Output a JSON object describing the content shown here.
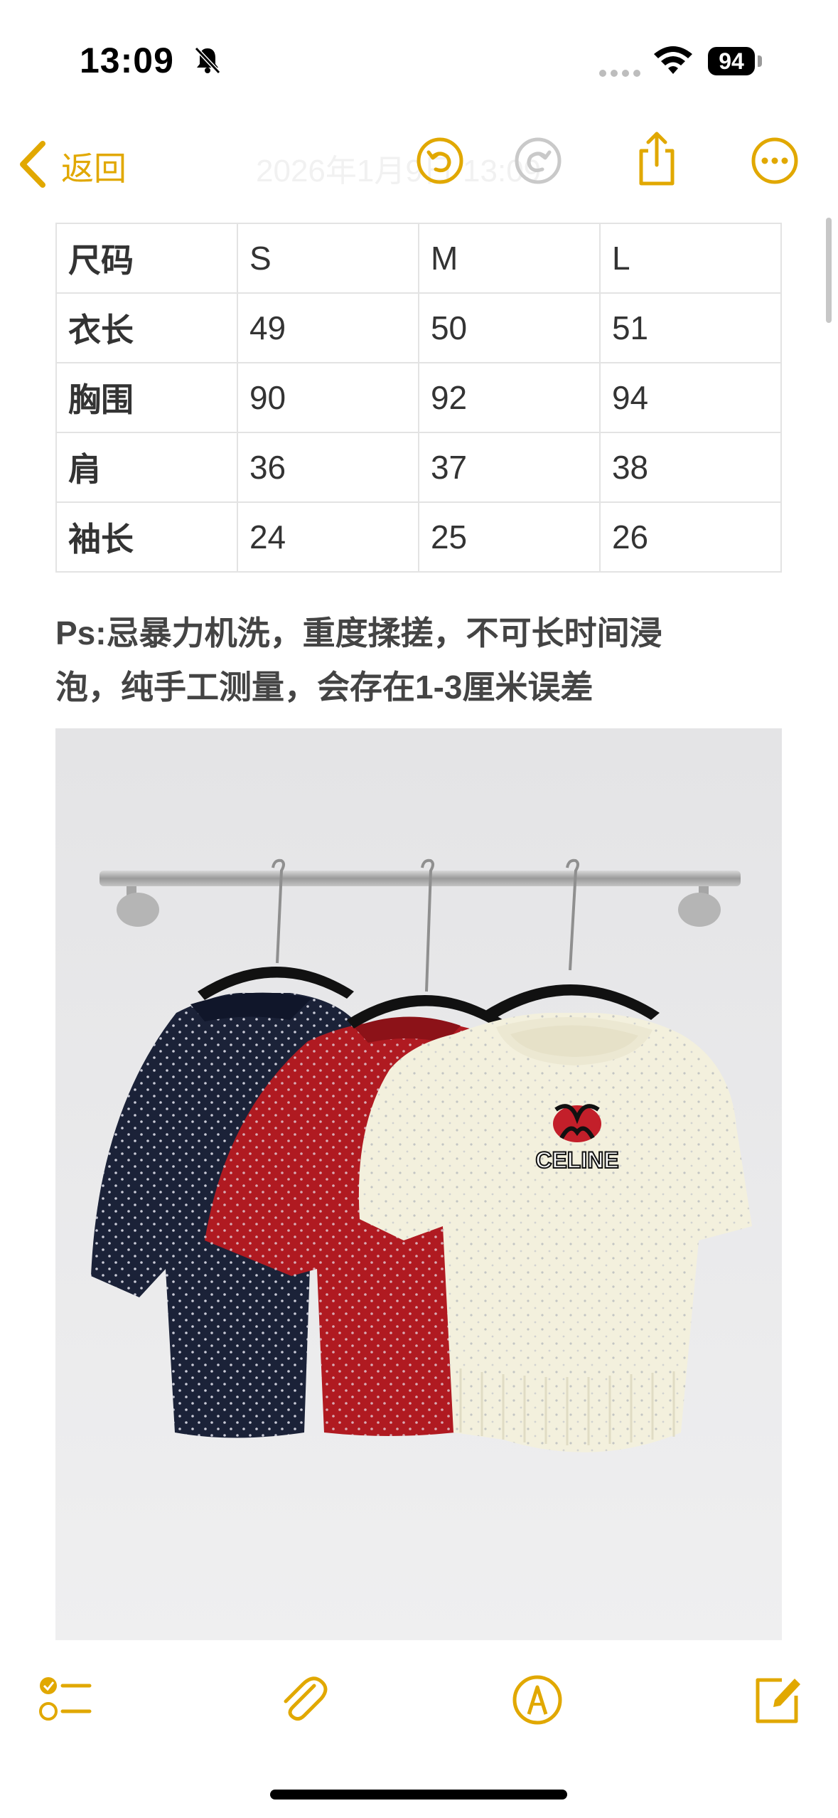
{
  "status": {
    "time": "13:09",
    "battery": "94",
    "icons": [
      "bell-slash-icon",
      "cellular-dots-icon",
      "wifi-icon",
      "battery-icon"
    ]
  },
  "nav": {
    "back_label": "返回",
    "title": "2026年1月9日 13:09",
    "icons": [
      "chevron-left-icon",
      "undo-icon",
      "redo-icon",
      "share-icon",
      "more-icon"
    ],
    "accent": "#e1a800"
  },
  "size_table": {
    "rows": [
      [
        "尺码",
        "S",
        "M",
        "L"
      ],
      [
        "衣长",
        "49",
        "50",
        "51"
      ],
      [
        "胸围",
        "90",
        "92",
        "94"
      ],
      [
        "肩",
        "36",
        "37",
        "38"
      ],
      [
        "袖长",
        "24",
        "25",
        "26"
      ]
    ]
  },
  "note": {
    "line1": "Ps:忌暴力机洗，重度揉搓，不可长时间浸",
    "line2": "泡，纯手工测量，会存在1-3厘米误差"
  },
  "photo": {
    "brand": "CELINE",
    "colors": {
      "wall": "#e8e8e8",
      "navy": "#1b2238",
      "red": "#b01a21",
      "cream": "#f3f0dd"
    }
  },
  "toolbar": {
    "icons": [
      "checklist-icon",
      "paperclip-icon",
      "markup-pen-icon",
      "compose-icon"
    ]
  }
}
